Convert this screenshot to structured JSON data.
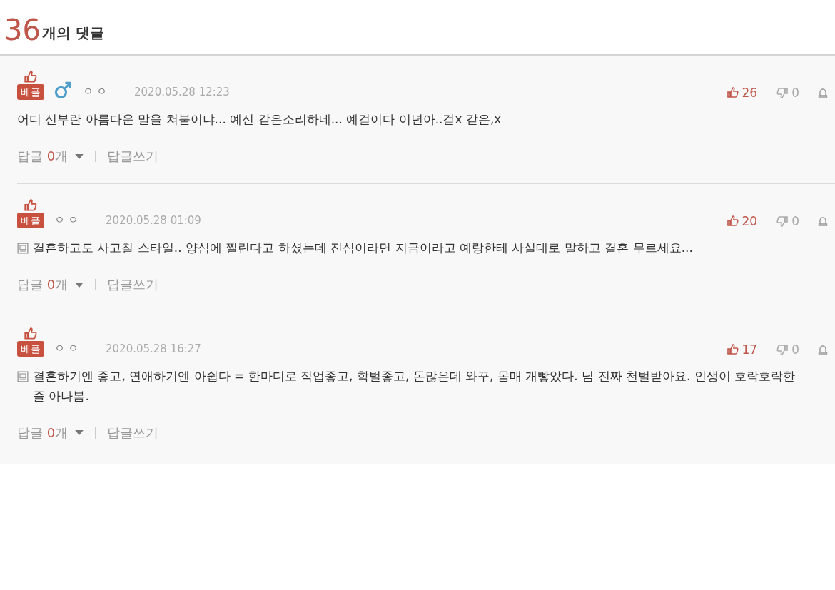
{
  "header": {
    "count": "36",
    "label": "개의 댓글"
  },
  "comments": [
    {
      "best": true,
      "best_label": "베플",
      "male": true,
      "author": "ㅇㅇ",
      "date": "2020.05.28 12:23",
      "likes": "26",
      "dislikes": "0",
      "mobile": false,
      "text": "어디 신부란 아름다운 말을 쳐붙이냐... 예신 같은소리하네... 예걸이다 이년아..걸x 같은,x",
      "reply_label": "답글",
      "reply_count": "0",
      "reply_unit": "개",
      "write_reply": "답글쓰기"
    },
    {
      "best": true,
      "best_label": "베플",
      "male": false,
      "author": "ㅇㅇ",
      "date": "2020.05.28 01:09",
      "likes": "20",
      "dislikes": "0",
      "mobile": true,
      "text": "결혼하고도 사고칠 스타일.. 양심에 찔린다고 하셨는데 진심이라면 지금이라고 예랑한테 사실대로 말하고 결혼 무르세요...",
      "reply_label": "답글",
      "reply_count": "0",
      "reply_unit": "개",
      "write_reply": "답글쓰기"
    },
    {
      "best": true,
      "best_label": "베플",
      "male": false,
      "author": "ㅇㅇ",
      "date": "2020.05.28 16:27",
      "likes": "17",
      "dislikes": "0",
      "mobile": true,
      "text": "결혼하기엔 좋고, 연애하기엔 아쉽다 = 한마디로 직업좋고, 학벌좋고, 돈많은데 와꾸, 몸매 개빻았다. 님 진짜 천벌받아요. 인생이 호락호락한 줄 아나봄.",
      "reply_label": "답글",
      "reply_count": "0",
      "reply_unit": "개",
      "write_reply": "답글쓰기"
    }
  ]
}
